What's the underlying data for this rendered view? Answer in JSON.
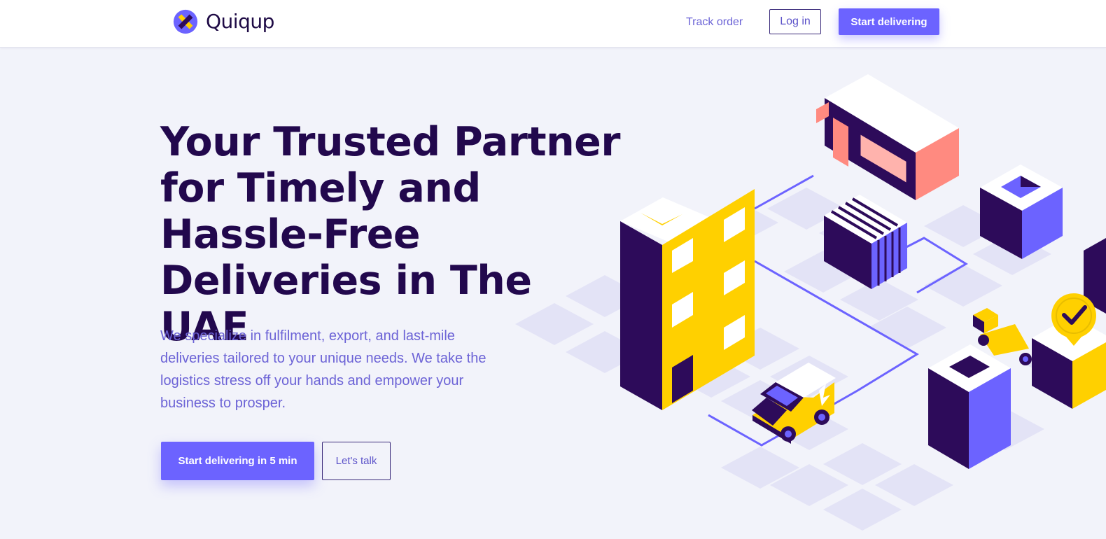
{
  "header": {
    "brand": "Quiqup",
    "nav": {
      "track_order": "Track order",
      "log_in": "Log in",
      "start_delivering": "Start delivering"
    }
  },
  "hero": {
    "title": "Your Trusted Partner for Timely and Hassle-Free Deliveries in The UAE",
    "subtitle": "We specialize in fulfilment, export, and last-mile deliveries tailored to your unique needs. We take the logistics stress off your hands and empower your business to prosper.",
    "primary_cta": "Start delivering in 5 min",
    "secondary_cta": "Let's talk"
  },
  "colors": {
    "accent": "#6c63ff",
    "heading": "#22084d",
    "body_text": "#6c63d6",
    "background": "#f2f3fa",
    "yellow": "#ffd000",
    "dark_purple": "#2d0b5a",
    "salmon": "#ff8a80"
  },
  "icons": {
    "logo": "quiqup-logo-icon",
    "illustration": "isometric-city-delivery-illustration"
  }
}
